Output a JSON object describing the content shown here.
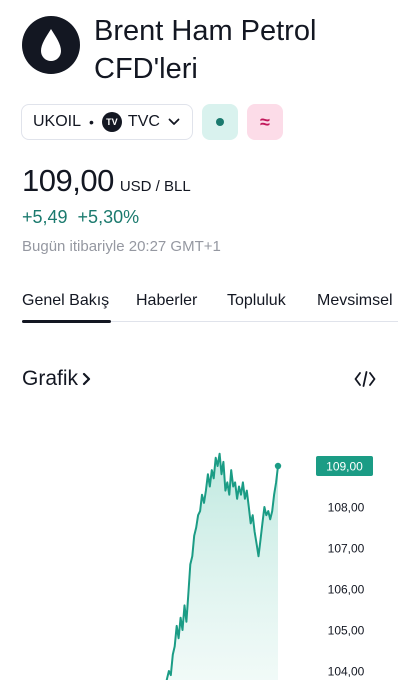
{
  "header": {
    "title": "Brent Ham Petrol CFD'leri",
    "logo_icon": "oil-drop-icon"
  },
  "symbol": {
    "ticker": "UKOIL",
    "separator": "•",
    "exchange_logo_text": "TV",
    "exchange": "TVC",
    "dropdown_icon": "chevron-down-icon",
    "status_icon": "market-open-dot-icon",
    "approx_label": "≈"
  },
  "quote": {
    "price": "109,00",
    "currency": "USD / BLL",
    "change_abs": "+5,49",
    "change_pct": "+5,30%",
    "timestamp": "Bugün itibariyle 20:27 GMT+1"
  },
  "tabs": [
    {
      "label": "Genel Bakış",
      "active": true
    },
    {
      "label": "Haberler",
      "active": false
    },
    {
      "label": "Topluluk",
      "active": false
    },
    {
      "label": "Mevsimsel",
      "active": false
    }
  ],
  "section": {
    "title": "Grafik",
    "embed_icon": "code-embed-icon"
  },
  "colors": {
    "accent": "#1b9c85",
    "positive": "#1b7a6e",
    "fill_top": "#b8e6dc",
    "muted": "#9598a1"
  },
  "chart_data": {
    "type": "area",
    "y_ticks": [
      "109,00",
      "108,00",
      "107,00",
      "106,00",
      "105,00",
      "104,00"
    ],
    "last_value_label": "109,00",
    "ylim": [
      103.9,
      109.35
    ],
    "values": [
      103.5,
      103.8,
      104.0,
      103.9,
      104.4,
      104.6,
      105.1,
      104.8,
      105.3,
      105.0,
      105.6,
      105.2,
      105.9,
      106.6,
      106.8,
      107.3,
      107.5,
      107.8,
      107.9,
      108.3,
      108.1,
      108.4,
      108.8,
      108.5,
      108.9,
      108.7,
      109.2,
      109.0,
      109.3,
      108.8,
      109.1,
      108.4,
      108.6,
      108.3,
      108.9,
      108.5,
      108.6,
      108.2,
      108.5,
      108.3,
      108.6,
      108.2,
      108.4,
      108.0,
      107.6,
      107.8,
      107.4,
      107.1,
      106.8,
      107.2,
      107.6,
      108.0,
      107.8,
      107.9,
      107.7,
      107.9,
      108.3,
      108.6,
      109.0
    ]
  }
}
